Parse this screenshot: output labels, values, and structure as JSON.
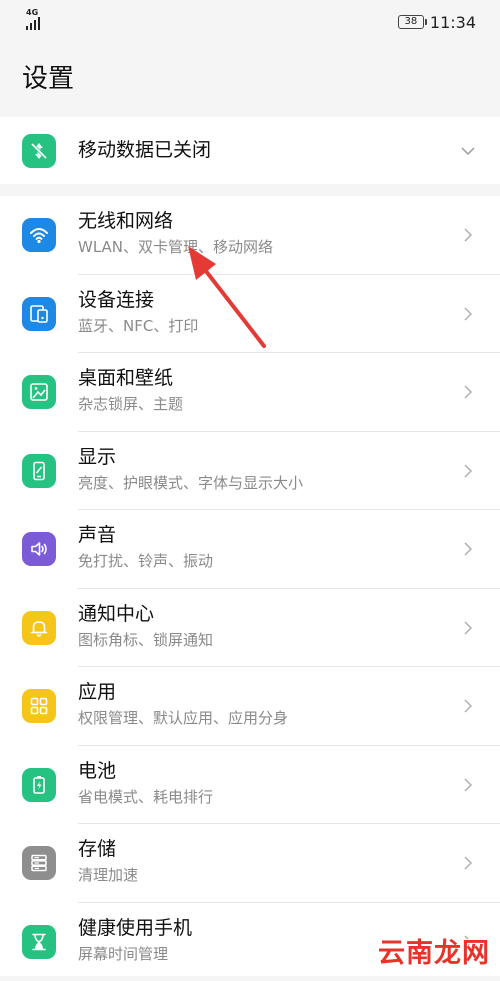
{
  "status_bar": {
    "network": "4G",
    "battery": "38",
    "time": "11:34"
  },
  "page": {
    "title": "设置"
  },
  "mobile_data": {
    "title": "移动数据已关闭",
    "icon": "mobile-data-off-icon",
    "color": "#2ecc71"
  },
  "items": [
    {
      "name": "wireless-network",
      "title": "无线和网络",
      "subtitle": "WLAN、双卡管理、移动网络",
      "icon": "wifi-icon",
      "color": "#1e88e5"
    },
    {
      "name": "device-connection",
      "title": "设备连接",
      "subtitle": "蓝牙、NFC、打印",
      "icon": "device-connection-icon",
      "color": "#1e88e5"
    },
    {
      "name": "desktop-wallpaper",
      "title": "桌面和壁纸",
      "subtitle": "杂志锁屏、主题",
      "icon": "wallpaper-icon",
      "color": "#26c281"
    },
    {
      "name": "display",
      "title": "显示",
      "subtitle": "亮度、护眼模式、字体与显示大小",
      "icon": "display-icon",
      "color": "#26c281"
    },
    {
      "name": "sound",
      "title": "声音",
      "subtitle": "免打扰、铃声、振动",
      "icon": "speaker-icon",
      "color": "#7b5cd6"
    },
    {
      "name": "notification-center",
      "title": "通知中心",
      "subtitle": "图标角标、锁屏通知",
      "icon": "bell-icon",
      "color": "#f5c518"
    },
    {
      "name": "apps",
      "title": "应用",
      "subtitle": "权限管理、默认应用、应用分身",
      "icon": "apps-grid-icon",
      "color": "#f5c518"
    },
    {
      "name": "battery",
      "title": "电池",
      "subtitle": "省电模式、耗电排行",
      "icon": "battery-icon",
      "color": "#26c281"
    },
    {
      "name": "storage",
      "title": "存储",
      "subtitle": "清理加速",
      "icon": "storage-icon",
      "color": "#8e8e8e"
    },
    {
      "name": "digital-health",
      "title": "健康使用手机",
      "subtitle": "屏幕时间管理",
      "icon": "hourglass-icon",
      "color": "#26c281"
    }
  ],
  "watermark": "云南龙网"
}
